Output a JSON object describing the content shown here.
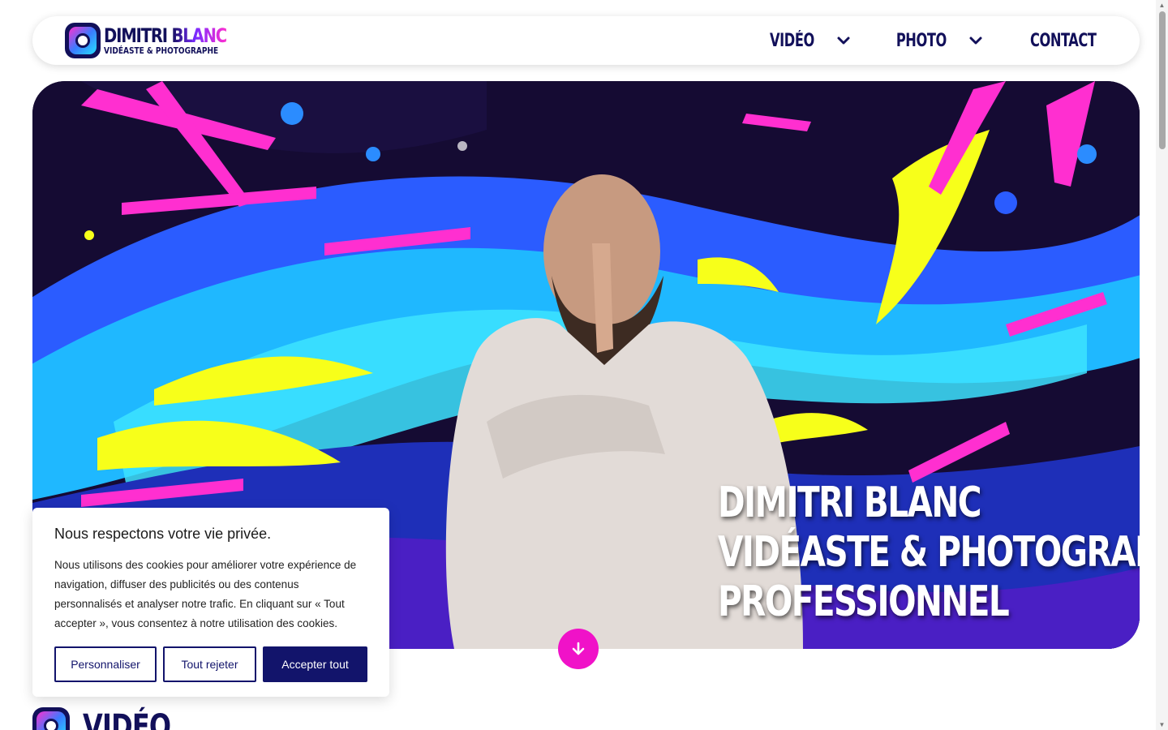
{
  "brand": {
    "name": "DIMITRI BLANC",
    "tagline": "VIDÉASTE & PHOTOGRAPHE"
  },
  "nav": {
    "items": [
      {
        "label": "VIDÉO",
        "has_dropdown": true
      },
      {
        "label": "PHOTO",
        "has_dropdown": true
      },
      {
        "label": "CONTACT",
        "has_dropdown": false
      }
    ]
  },
  "hero": {
    "lines": [
      "DIMITRI BLANC",
      "VIDÉASTE & PHOTOGRAPHE",
      "PROFESSIONNEL"
    ]
  },
  "cookie": {
    "title": "Nous respectons votre vie privée.",
    "text": "Nous utilisons des cookies pour améliorer votre expérience de navigation, diffuser des publicités ou des contenus personnalisés et analyser notre trafic. En cliquant sur « Tout accepter », vous consentez à notre utilisation des cookies.",
    "customize_label": "Personnaliser",
    "reject_label": "Tout rejeter",
    "accept_label": "Accepter tout"
  },
  "section": {
    "title": "VIDÉO"
  },
  "colors": {
    "navy": "#12105a",
    "magenta": "#f012c8",
    "button_blue": "#12146b"
  }
}
